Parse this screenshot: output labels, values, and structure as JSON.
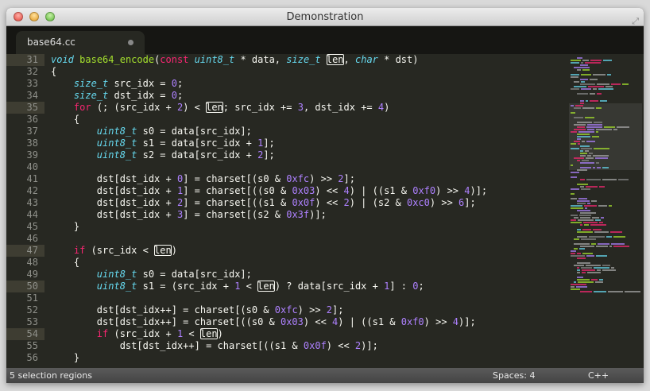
{
  "window": {
    "title": "Demonstration"
  },
  "tab": {
    "label": "base64.cc"
  },
  "status": {
    "selection": "5 selection regions",
    "indent": "Spaces: 4",
    "syntax": "C++"
  },
  "colors": {
    "keyword": "#f92672",
    "type": "#66d9ef",
    "function": "#a6e22e",
    "number": "#ae81ff",
    "text": "#f8f8f2",
    "bg": "#272822"
  },
  "current_lines": [
    31,
    35,
    47,
    50,
    54
  ],
  "lines": [
    {
      "no": "31",
      "tokens": [
        [
          "t",
          "void"
        ],
        [
          "p",
          " "
        ],
        [
          "f",
          "base64_encode"
        ],
        [
          "p",
          "("
        ],
        [
          "k",
          "const"
        ],
        [
          "p",
          " "
        ],
        [
          "t",
          "uint8_t"
        ],
        [
          "p",
          " * data, "
        ],
        [
          "t",
          "size_t"
        ],
        [
          "p",
          " "
        ],
        [
          "s",
          "len"
        ],
        [
          "p",
          ", "
        ],
        [
          "t",
          "char"
        ],
        [
          "p",
          " * dst)"
        ]
      ]
    },
    {
      "no": "32",
      "tokens": [
        [
          "p",
          "{"
        ]
      ]
    },
    {
      "no": "33",
      "tokens": [
        [
          "p",
          "    "
        ],
        [
          "t",
          "size_t"
        ],
        [
          "p",
          " src_idx = "
        ],
        [
          "n",
          "0"
        ],
        [
          "p",
          ";"
        ]
      ]
    },
    {
      "no": "34",
      "tokens": [
        [
          "p",
          "    "
        ],
        [
          "t",
          "size_t"
        ],
        [
          "p",
          " dst_idx = "
        ],
        [
          "n",
          "0"
        ],
        [
          "p",
          ";"
        ]
      ]
    },
    {
      "no": "35",
      "tokens": [
        [
          "p",
          "    "
        ],
        [
          "k",
          "for"
        ],
        [
          "p",
          " (; (src_idx + "
        ],
        [
          "n",
          "2"
        ],
        [
          "p",
          ") < "
        ],
        [
          "s",
          "len"
        ],
        [
          "p",
          "; src_idx += "
        ],
        [
          "n",
          "3"
        ],
        [
          "p",
          ", dst_idx += "
        ],
        [
          "n",
          "4"
        ],
        [
          "p",
          ")"
        ]
      ]
    },
    {
      "no": "36",
      "tokens": [
        [
          "p",
          "    {"
        ]
      ]
    },
    {
      "no": "37",
      "tokens": [
        [
          "p",
          "        "
        ],
        [
          "t",
          "uint8_t"
        ],
        [
          "p",
          " s0 = data[src_idx];"
        ]
      ]
    },
    {
      "no": "38",
      "tokens": [
        [
          "p",
          "        "
        ],
        [
          "t",
          "uint8_t"
        ],
        [
          "p",
          " s1 = data[src_idx + "
        ],
        [
          "n",
          "1"
        ],
        [
          "p",
          "];"
        ]
      ]
    },
    {
      "no": "39",
      "tokens": [
        [
          "p",
          "        "
        ],
        [
          "t",
          "uint8_t"
        ],
        [
          "p",
          " s2 = data[src_idx + "
        ],
        [
          "n",
          "2"
        ],
        [
          "p",
          "];"
        ]
      ]
    },
    {
      "no": "40",
      "tokens": []
    },
    {
      "no": "41",
      "tokens": [
        [
          "p",
          "        dst[dst_idx + "
        ],
        [
          "n",
          "0"
        ],
        [
          "p",
          "] = charset[(s0 & "
        ],
        [
          "n",
          "0xfc"
        ],
        [
          "p",
          ") >> "
        ],
        [
          "n",
          "2"
        ],
        [
          "p",
          "];"
        ]
      ]
    },
    {
      "no": "42",
      "tokens": [
        [
          "p",
          "        dst[dst_idx + "
        ],
        [
          "n",
          "1"
        ],
        [
          "p",
          "] = charset[((s0 & "
        ],
        [
          "n",
          "0x03"
        ],
        [
          "p",
          ") << "
        ],
        [
          "n",
          "4"
        ],
        [
          "p",
          ") | ((s1 & "
        ],
        [
          "n",
          "0xf0"
        ],
        [
          "p",
          ") >> "
        ],
        [
          "n",
          "4"
        ],
        [
          "p",
          ")];"
        ]
      ]
    },
    {
      "no": "43",
      "tokens": [
        [
          "p",
          "        dst[dst_idx + "
        ],
        [
          "n",
          "2"
        ],
        [
          "p",
          "] = charset[((s1 & "
        ],
        [
          "n",
          "0x0f"
        ],
        [
          "p",
          ") << "
        ],
        [
          "n",
          "2"
        ],
        [
          "p",
          ") | (s2 & "
        ],
        [
          "n",
          "0xc0"
        ],
        [
          "p",
          ") >> "
        ],
        [
          "n",
          "6"
        ],
        [
          "p",
          "];"
        ]
      ]
    },
    {
      "no": "44",
      "tokens": [
        [
          "p",
          "        dst[dst_idx + "
        ],
        [
          "n",
          "3"
        ],
        [
          "p",
          "] = charset[(s2 & "
        ],
        [
          "n",
          "0x3f"
        ],
        [
          "p",
          ")];"
        ]
      ]
    },
    {
      "no": "45",
      "tokens": [
        [
          "p",
          "    }"
        ]
      ]
    },
    {
      "no": "46",
      "tokens": []
    },
    {
      "no": "47",
      "tokens": [
        [
          "p",
          "    "
        ],
        [
          "k",
          "if"
        ],
        [
          "p",
          " (src_idx < "
        ],
        [
          "s",
          "len"
        ],
        [
          "p",
          ")"
        ]
      ]
    },
    {
      "no": "48",
      "tokens": [
        [
          "p",
          "    {"
        ]
      ]
    },
    {
      "no": "49",
      "tokens": [
        [
          "p",
          "        "
        ],
        [
          "t",
          "uint8_t"
        ],
        [
          "p",
          " s0 = data[src_idx];"
        ]
      ]
    },
    {
      "no": "50",
      "tokens": [
        [
          "p",
          "        "
        ],
        [
          "t",
          "uint8_t"
        ],
        [
          "p",
          " s1 = (src_idx + "
        ],
        [
          "n",
          "1"
        ],
        [
          "p",
          " < "
        ],
        [
          "s",
          "len"
        ],
        [
          "p",
          ") ? data[src_idx + "
        ],
        [
          "n",
          "1"
        ],
        [
          "p",
          "] : "
        ],
        [
          "n",
          "0"
        ],
        [
          "p",
          ";"
        ]
      ]
    },
    {
      "no": "51",
      "tokens": []
    },
    {
      "no": "52",
      "tokens": [
        [
          "p",
          "        dst[dst_idx++] = charset[(s0 & "
        ],
        [
          "n",
          "0xfc"
        ],
        [
          "p",
          ") >> "
        ],
        [
          "n",
          "2"
        ],
        [
          "p",
          "];"
        ]
      ]
    },
    {
      "no": "53",
      "tokens": [
        [
          "p",
          "        dst[dst_idx++] = charset[((s0 & "
        ],
        [
          "n",
          "0x03"
        ],
        [
          "p",
          ") << "
        ],
        [
          "n",
          "4"
        ],
        [
          "p",
          ") | ((s1 & "
        ],
        [
          "n",
          "0xf0"
        ],
        [
          "p",
          ") >> "
        ],
        [
          "n",
          "4"
        ],
        [
          "p",
          ")];"
        ]
      ]
    },
    {
      "no": "54",
      "tokens": [
        [
          "p",
          "        "
        ],
        [
          "k",
          "if"
        ],
        [
          "p",
          " (src_idx + "
        ],
        [
          "n",
          "1"
        ],
        [
          "p",
          " < "
        ],
        [
          "s",
          "len"
        ],
        [
          "p",
          ")"
        ]
      ]
    },
    {
      "no": "55",
      "tokens": [
        [
          "p",
          "            dst[dst_idx++] = charset[((s1 & "
        ],
        [
          "n",
          "0x0f"
        ],
        [
          "p",
          ") << "
        ],
        [
          "n",
          "2"
        ],
        [
          "p",
          ")];"
        ]
      ]
    },
    {
      "no": "56",
      "tokens": [
        [
          "p",
          "    }"
        ]
      ]
    }
  ]
}
